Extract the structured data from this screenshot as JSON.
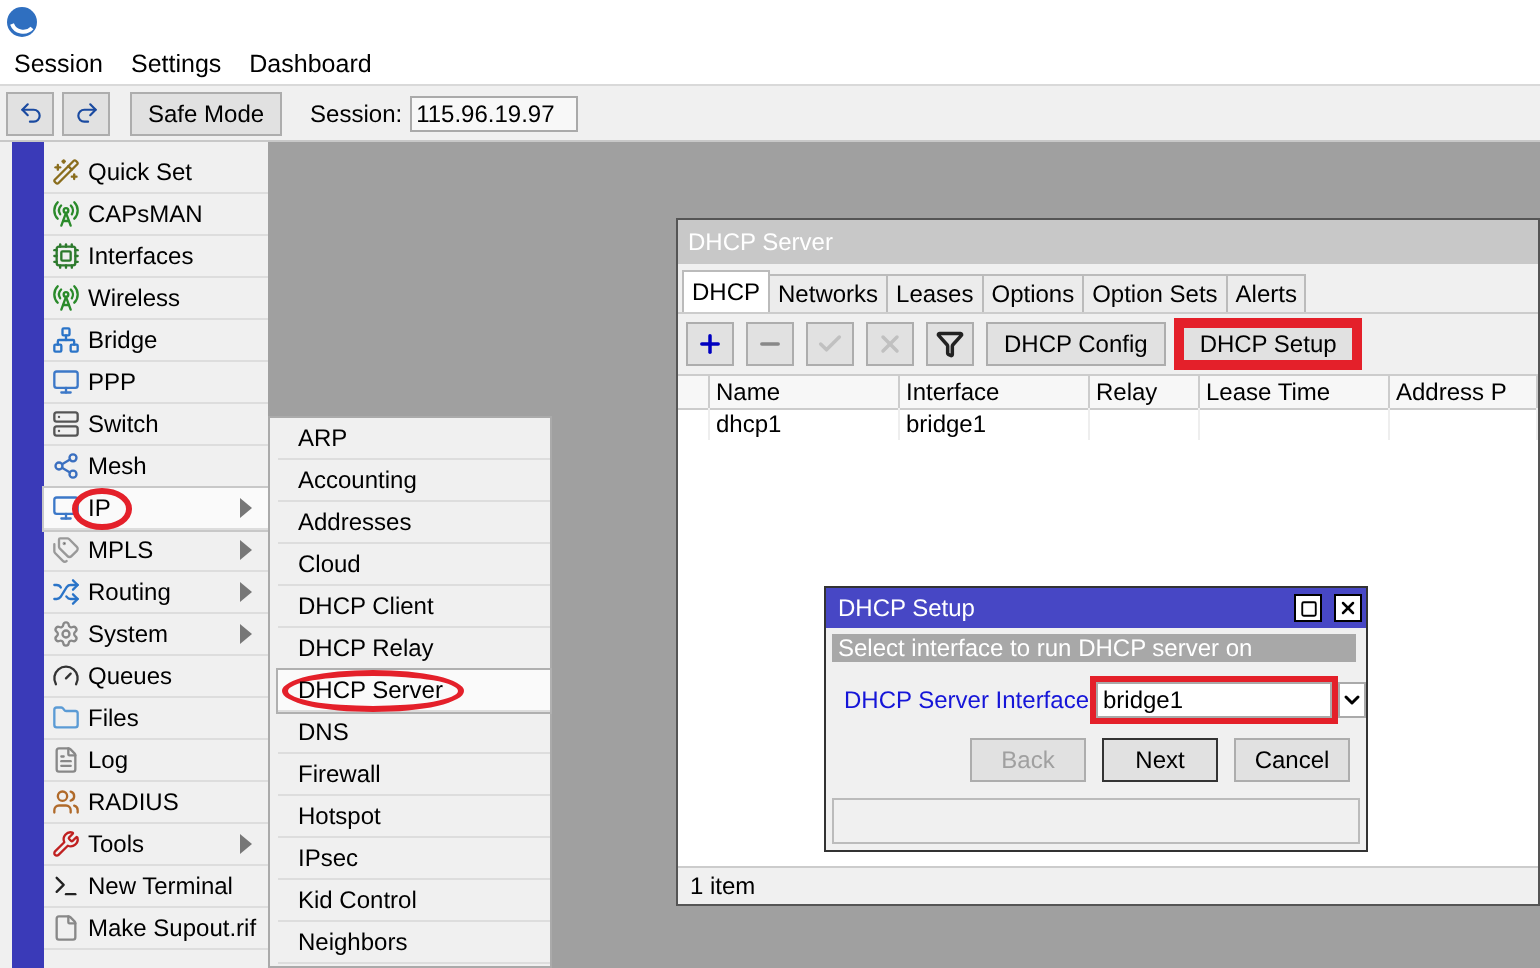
{
  "menubar": [
    "Session",
    "Settings",
    "Dashboard"
  ],
  "toolbar": {
    "safe_mode": "Safe Mode",
    "session_label": "Session:",
    "session_value": "115.96.19.97"
  },
  "sidebar": {
    "items": [
      {
        "label": "Quick Set",
        "submenu": false,
        "selected": false,
        "highlighted": false
      },
      {
        "label": "CAPsMAN",
        "submenu": false,
        "selected": false,
        "highlighted": false
      },
      {
        "label": "Interfaces",
        "submenu": false,
        "selected": false,
        "highlighted": false
      },
      {
        "label": "Wireless",
        "submenu": false,
        "selected": false,
        "highlighted": false
      },
      {
        "label": "Bridge",
        "submenu": false,
        "selected": false,
        "highlighted": false
      },
      {
        "label": "PPP",
        "submenu": false,
        "selected": false,
        "highlighted": false
      },
      {
        "label": "Switch",
        "submenu": false,
        "selected": false,
        "highlighted": false
      },
      {
        "label": "Mesh",
        "submenu": false,
        "selected": false,
        "highlighted": false
      },
      {
        "label": "IP",
        "submenu": true,
        "selected": true,
        "highlighted": true
      },
      {
        "label": "MPLS",
        "submenu": true,
        "selected": false,
        "highlighted": false
      },
      {
        "label": "Routing",
        "submenu": true,
        "selected": false,
        "highlighted": false
      },
      {
        "label": "System",
        "submenu": true,
        "selected": false,
        "highlighted": false
      },
      {
        "label": "Queues",
        "submenu": false,
        "selected": false,
        "highlighted": false
      },
      {
        "label": "Files",
        "submenu": false,
        "selected": false,
        "highlighted": false
      },
      {
        "label": "Log",
        "submenu": false,
        "selected": false,
        "highlighted": false
      },
      {
        "label": "RADIUS",
        "submenu": false,
        "selected": false,
        "highlighted": false
      },
      {
        "label": "Tools",
        "submenu": true,
        "selected": false,
        "highlighted": false
      },
      {
        "label": "New Terminal",
        "submenu": false,
        "selected": false,
        "highlighted": false
      },
      {
        "label": "Make Supout.rif",
        "submenu": false,
        "selected": false,
        "highlighted": false
      }
    ]
  },
  "submenu": {
    "items": [
      {
        "label": "ARP",
        "selected": false,
        "highlighted": false
      },
      {
        "label": "Accounting",
        "selected": false,
        "highlighted": false
      },
      {
        "label": "Addresses",
        "selected": false,
        "highlighted": false
      },
      {
        "label": "Cloud",
        "selected": false,
        "highlighted": false
      },
      {
        "label": "DHCP Client",
        "selected": false,
        "highlighted": false
      },
      {
        "label": "DHCP Relay",
        "selected": false,
        "highlighted": false
      },
      {
        "label": "DHCP Server",
        "selected": true,
        "highlighted": true
      },
      {
        "label": "DNS",
        "selected": false,
        "highlighted": false
      },
      {
        "label": "Firewall",
        "selected": false,
        "highlighted": false
      },
      {
        "label": "Hotspot",
        "selected": false,
        "highlighted": false
      },
      {
        "label": "IPsec",
        "selected": false,
        "highlighted": false
      },
      {
        "label": "Kid Control",
        "selected": false,
        "highlighted": false
      },
      {
        "label": "Neighbors",
        "selected": false,
        "highlighted": false
      }
    ]
  },
  "dhcp_window": {
    "title": "DHCP Server",
    "tabs": [
      {
        "label": "DHCP",
        "selected": true
      },
      {
        "label": "Networks",
        "selected": false
      },
      {
        "label": "Leases",
        "selected": false
      },
      {
        "label": "Options",
        "selected": false
      },
      {
        "label": "Option Sets",
        "selected": false
      },
      {
        "label": "Alerts",
        "selected": false
      }
    ],
    "tool_buttons": [
      {
        "kind": "add",
        "disabled": false
      },
      {
        "kind": "remove",
        "disabled": false
      },
      {
        "kind": "enable",
        "disabled": true
      },
      {
        "kind": "disable",
        "disabled": true
      },
      {
        "kind": "filter",
        "disabled": false
      }
    ],
    "buttons": [
      {
        "label": "DHCP Config",
        "highlighted": false
      },
      {
        "label": "DHCP Setup",
        "highlighted": true
      }
    ],
    "table": {
      "columns": [
        "Name",
        "Interface",
        "Relay",
        "Lease Time",
        "Address P"
      ],
      "rows": [
        [
          "dhcp1",
          "bridge1",
          "",
          "",
          ""
        ]
      ]
    },
    "status": "1 item"
  },
  "dialog": {
    "title": "DHCP Setup",
    "hint": "Select interface to run DHCP server on",
    "field_label": "DHCP Server Interface",
    "field_value": "bridge1",
    "field_highlighted": true,
    "buttons": [
      {
        "label": "Back",
        "disabled": true,
        "default": false
      },
      {
        "label": "Next",
        "disabled": false,
        "default": true
      },
      {
        "label": "Cancel",
        "disabled": false,
        "default": false
      }
    ]
  }
}
